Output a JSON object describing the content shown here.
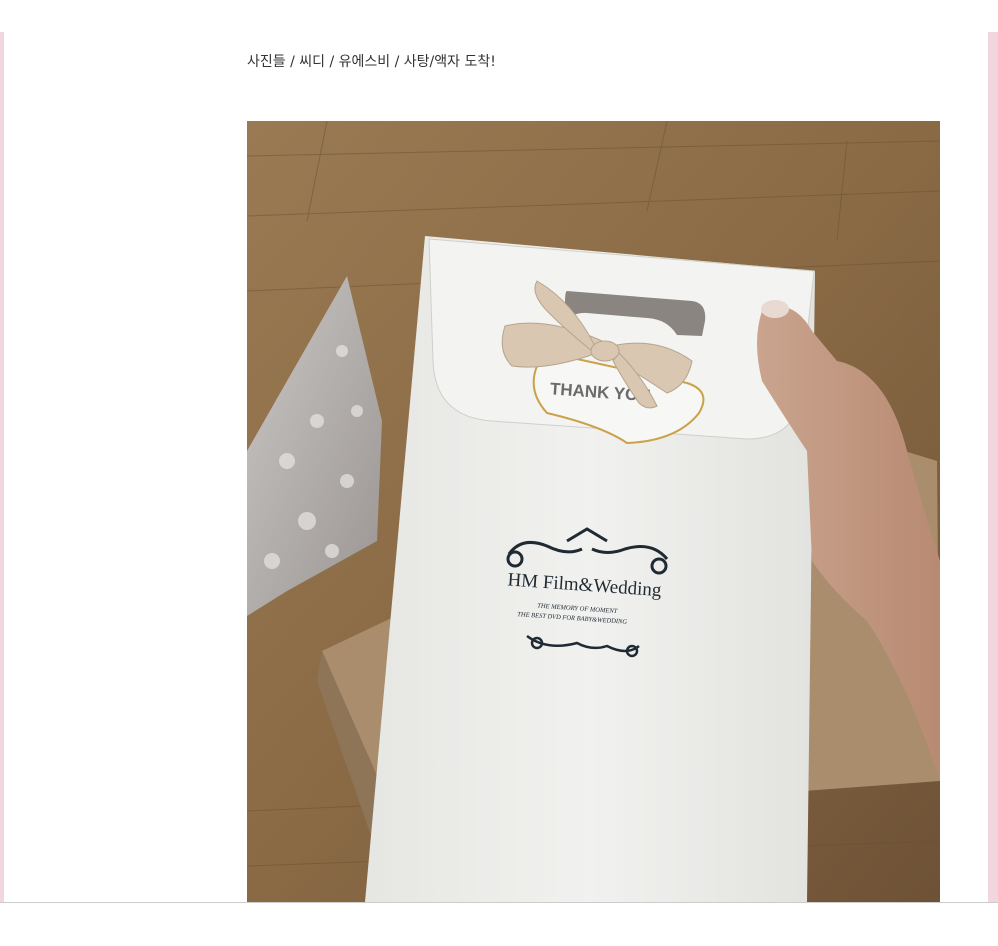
{
  "post": {
    "caption": "사진들 / 씨디 / 유에스비 / 사탕/액자 도착!"
  },
  "photo": {
    "tag_text": "THANK YOU",
    "brand_name": "HM Film&Wedding",
    "tagline_1": "THE MEMORY OF MOMENT",
    "tagline_2": "THE BEST DVD FOR BABY&WEDDING"
  },
  "colors": {
    "accent_pink": "#f2d6de",
    "floor": "#8c6a43",
    "bag": "#eeeeec"
  }
}
